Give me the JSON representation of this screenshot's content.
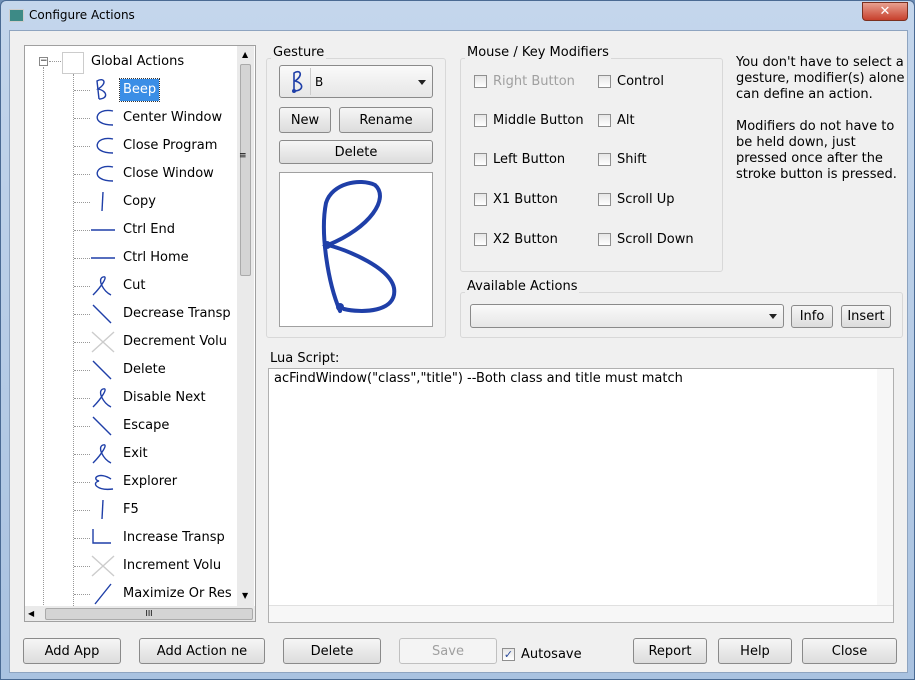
{
  "window": {
    "title": "Configure Actions",
    "close_glyph": "✕"
  },
  "tree": {
    "root": "Global Actions",
    "selected": "Beep",
    "items": [
      {
        "label": "Beep",
        "icon": "gesture-b-icon"
      },
      {
        "label": "Center Window",
        "icon": "gesture-c-icon"
      },
      {
        "label": "Close Program",
        "icon": "gesture-c-icon"
      },
      {
        "label": "Close Window",
        "icon": "gesture-c-icon"
      },
      {
        "label": "Copy",
        "icon": "gesture-down-icon"
      },
      {
        "label": "Ctrl End",
        "icon": "gesture-right-icon"
      },
      {
        "label": "Ctrl Home",
        "icon": "gesture-right-icon"
      },
      {
        "label": "Cut",
        "icon": "gesture-loop-icon"
      },
      {
        "label": "Decrease Transp",
        "icon": "gesture-diagonal-icon"
      },
      {
        "label": "Decrement Volu",
        "icon": "gesture-x-icon"
      },
      {
        "label": "Delete",
        "icon": "gesture-diagonal-icon"
      },
      {
        "label": "Disable Next",
        "icon": "gesture-loop-icon"
      },
      {
        "label": "Escape",
        "icon": "gesture-diagonal-icon"
      },
      {
        "label": "Exit",
        "icon": "gesture-loop-icon"
      },
      {
        "label": "Explorer",
        "icon": "gesture-e-icon"
      },
      {
        "label": "F5",
        "icon": "gesture-down-icon"
      },
      {
        "label": "Increase Transp",
        "icon": "gesture-corner-icon"
      },
      {
        "label": "Increment Volu",
        "icon": "gesture-x-icon"
      },
      {
        "label": "Maximize Or Res",
        "icon": "gesture-up-icon"
      }
    ],
    "hscroll_glyph": "III"
  },
  "gesture": {
    "label": "Gesture",
    "selected": "B",
    "new": "New",
    "rename": "Rename",
    "delete": "Delete"
  },
  "modifiers": {
    "label": "Mouse / Key Modifiers",
    "items": [
      {
        "label": "Right Button",
        "checked": false,
        "disabled": true
      },
      {
        "label": "Control",
        "checked": false
      },
      {
        "label": "Middle Button",
        "checked": false
      },
      {
        "label": "Alt",
        "checked": false
      },
      {
        "label": "Left Button",
        "checked": false
      },
      {
        "label": "Shift",
        "checked": false
      },
      {
        "label": "X1 Button",
        "checked": false
      },
      {
        "label": "Scroll Up",
        "checked": false
      },
      {
        "label": "X2 Button",
        "checked": false
      },
      {
        "label": "Scroll Down",
        "checked": false
      }
    ]
  },
  "help_text": {
    "p1": "You don't have to select a gesture, modifier(s) alone can define an action.",
    "p2": "Modifiers do not have to be held down, just pressed once after the stroke button is pressed."
  },
  "available": {
    "label": "Available Actions",
    "value": "",
    "info": "Info",
    "insert": "Insert"
  },
  "lua": {
    "label": "Lua Script:",
    "code": "acFindWindow(\"class\",\"title\") --Both class and title must match"
  },
  "footer": {
    "add_app": "Add App",
    "add_action": "Add Action ​​ne",
    "delete": "Delete",
    "save": "Save",
    "autosave": "Autosave",
    "autosave_checked": true,
    "report": "Report",
    "help": "Help",
    "close": "Close"
  },
  "colors": {
    "selection": "#3a8ee6",
    "stroke": "#1f3fa8"
  }
}
